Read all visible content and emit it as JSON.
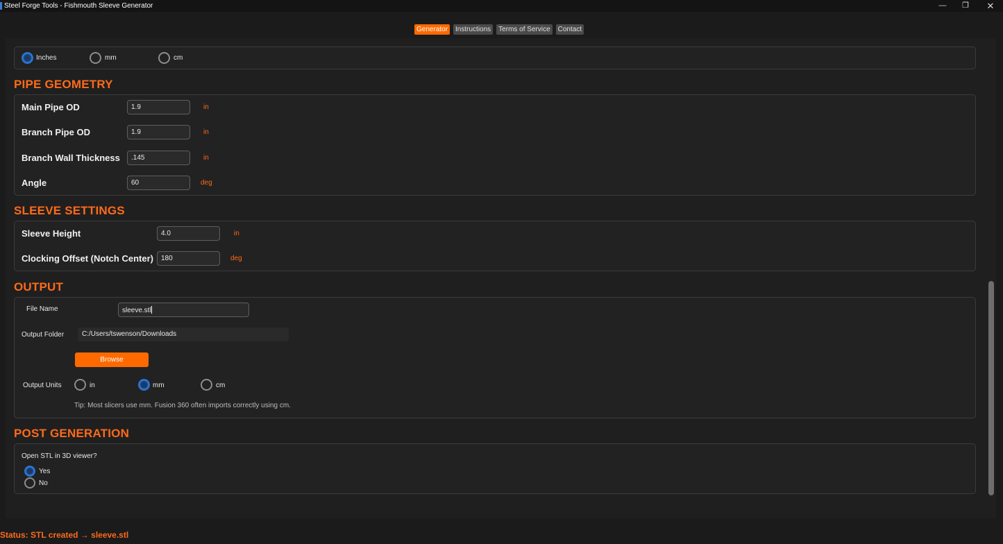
{
  "window": {
    "title": "Steel Forge Tools - Fishmouth Sleeve Generator",
    "min_glyph": "—",
    "max_glyph": "❐",
    "close_glyph": "✕"
  },
  "tabs": [
    {
      "label": "Generator",
      "active": true
    },
    {
      "label": "Instructions",
      "active": false
    },
    {
      "label": "Terms of Service",
      "active": false
    },
    {
      "label": "Contact",
      "active": false
    }
  ],
  "input_units": {
    "options": [
      {
        "label": "Inches",
        "selected": true
      },
      {
        "label": "mm",
        "selected": false
      },
      {
        "label": "cm",
        "selected": false
      }
    ]
  },
  "pipe_geometry": {
    "title": "PIPE GEOMETRY",
    "fields": [
      {
        "label": "Main Pipe OD",
        "value": "1.9",
        "unit": "in"
      },
      {
        "label": "Branch Pipe OD",
        "value": "1.9",
        "unit": "in"
      },
      {
        "label": "Branch Wall Thickness",
        "value": ".145",
        "unit": "in"
      },
      {
        "label": "Angle",
        "value": "60",
        "unit": "deg"
      }
    ]
  },
  "sleeve_settings": {
    "title": "SLEEVE SETTINGS",
    "fields": [
      {
        "label": "Sleeve Height",
        "value": "4.0",
        "unit": "in"
      },
      {
        "label": "Clocking Offset (Notch Center)",
        "value": "180",
        "unit": "deg"
      }
    ]
  },
  "output": {
    "title": "OUTPUT",
    "file_name_label": "File Name",
    "file_name_value": "sleeve.stl",
    "folder_label": "Output Folder",
    "folder_value": "C:/Users/tswenson/Downloads",
    "browse_label": "Browse",
    "units_label": "Output Units",
    "units_options": [
      {
        "label": "in",
        "selected": false
      },
      {
        "label": "mm",
        "selected": true
      },
      {
        "label": "cm",
        "selected": false
      }
    ],
    "tip": "Tip: Most slicers use mm. Fusion 360 often imports correctly using cm."
  },
  "post_generation": {
    "title": "POST GENERATION",
    "question": "Open STL in 3D viewer?",
    "options": [
      {
        "label": "Yes",
        "selected": true
      },
      {
        "label": "No",
        "selected": false
      }
    ]
  },
  "status": "Status: STL created → sleeve.stl",
  "colors": {
    "accent": "#ff6a00",
    "radio_selected": "#2a73d0",
    "background": "#1b1b1b"
  }
}
